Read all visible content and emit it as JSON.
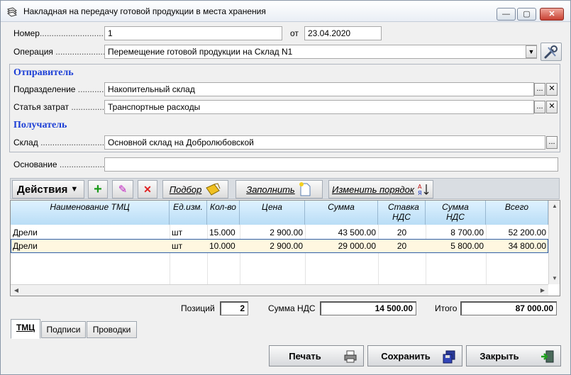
{
  "window": {
    "title": "Накладная на передачу готовой продукции в места хранения",
    "minimize": "—",
    "maximize": "▢",
    "close": "✕"
  },
  "header": {
    "number_label": "Номер",
    "number_value": "1",
    "date_label": "от",
    "date_value": "23.04.2020",
    "operation_label": "Операция",
    "operation_value": "Перемещение готовой продукции на Склад N1"
  },
  "sender": {
    "title": "Отправитель",
    "division_label": "Подразделение",
    "division_value": "Накопительный склад",
    "cost_label": "Статья затрат",
    "cost_value": "Транспортные расходы"
  },
  "receiver": {
    "title": "Получатель",
    "warehouse_label": "Склад",
    "warehouse_value": "Основной склад на Добролюбовской"
  },
  "basis": {
    "label": "Основание",
    "value": ""
  },
  "toolbar": {
    "actions": "Действия",
    "add": "+",
    "edit": "✎",
    "delete": "✕",
    "select": "Подбор",
    "fill": "Заполнить",
    "reorder": "Изменить порядок"
  },
  "grid": {
    "columns": [
      {
        "label": "Наименование ТМЦ"
      },
      {
        "label": "Ед.изм."
      },
      {
        "label": "Кол-во"
      },
      {
        "label": "Цена"
      },
      {
        "label": "Сумма"
      },
      {
        "label": "Ставка НДС"
      },
      {
        "label": "Сумма НДС"
      },
      {
        "label": "Всего"
      }
    ],
    "rows": [
      {
        "name": "Дрели",
        "unit": "шт",
        "qty": "15.000",
        "price": "2 900.00",
        "sum": "43 500.00",
        "vat_rate": "20",
        "vat_sum": "8 700.00",
        "total": "52 200.00"
      },
      {
        "name": "Дрели",
        "unit": "шт",
        "qty": "10.000",
        "price": "2 900.00",
        "sum": "29 000.00",
        "vat_rate": "20",
        "vat_sum": "5 800.00",
        "total": "34 800.00"
      }
    ]
  },
  "totals": {
    "positions_label": "Позиций",
    "positions_value": "2",
    "vat_label": "Сумма НДС",
    "vat_value": "14 500.00",
    "total_label": "Итого",
    "total_value": "87 000.00"
  },
  "tabs": [
    {
      "label": "ТМЦ"
    },
    {
      "label": "Подписи"
    },
    {
      "label": "Проводки"
    }
  ],
  "buttons": {
    "print": "Печать",
    "save": "Сохранить",
    "close": "Закрыть"
  },
  "colors": {
    "section_title": "#1d3fd6",
    "grid_header": "#b9ddf6",
    "selected_row": "#fff7e0"
  }
}
